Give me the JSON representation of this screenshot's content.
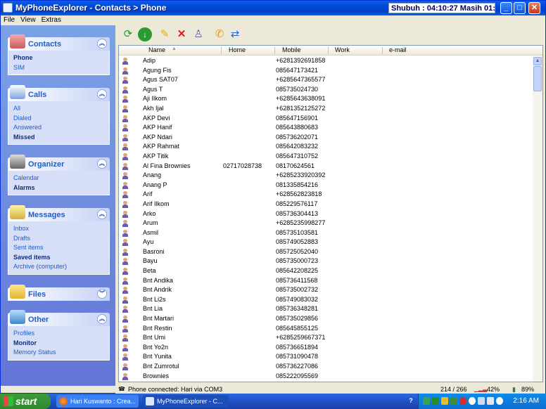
{
  "window": {
    "title": "MyPhoneExplorer  -  Contacts > Phone",
    "timer": "Shubuh : 04:10:27  Masih 01:54:25"
  },
  "menu": [
    "File",
    "View",
    "Extras"
  ],
  "sidebar": {
    "groups": [
      {
        "label": "Contacts",
        "items": [
          {
            "label": "Phone",
            "bold": true
          },
          {
            "label": "SIM",
            "bold": false
          }
        ]
      },
      {
        "label": "Calls",
        "items": [
          {
            "label": "All",
            "bold": false
          },
          {
            "label": "Dialed",
            "bold": false
          },
          {
            "label": "Answered",
            "bold": false
          },
          {
            "label": "Missed",
            "bold": true
          }
        ]
      },
      {
        "label": "Organizer",
        "items": [
          {
            "label": "Calendar",
            "bold": false
          },
          {
            "label": "Alarms",
            "bold": true
          }
        ]
      },
      {
        "label": "Messages",
        "items": [
          {
            "label": "Inbox",
            "bold": false
          },
          {
            "label": "Drafts",
            "bold": false
          },
          {
            "label": "Sent items",
            "bold": false
          },
          {
            "label": "Saved items",
            "bold": true
          },
          {
            "label": "Archive (computer)",
            "bold": false
          }
        ]
      },
      {
        "label": "Files",
        "items": []
      },
      {
        "label": "Other",
        "items": [
          {
            "label": "Profiles",
            "bold": false
          },
          {
            "label": "Monitor",
            "bold": true
          },
          {
            "label": "Memory Status",
            "bold": false
          }
        ]
      }
    ]
  },
  "toolbar": {
    "icons": [
      "refresh-icon",
      "download-icon",
      "edit-icon",
      "delete-icon",
      "add-contact-icon",
      "phone-icon",
      "sync-icon"
    ]
  },
  "table": {
    "columns": [
      "Name",
      "Home",
      "Mobile",
      "Work",
      "e-mail"
    ],
    "rows": [
      {
        "name": "Adip",
        "home": "",
        "mobile": "+6281392691858"
      },
      {
        "name": "Agung Fis",
        "home": "",
        "mobile": "085647173421"
      },
      {
        "name": "Agus SAT07",
        "home": "",
        "mobile": "+6285647365577"
      },
      {
        "name": "Agus T",
        "home": "",
        "mobile": "085735024730"
      },
      {
        "name": "Aji Ilkom",
        "home": "",
        "mobile": "+6285643638091"
      },
      {
        "name": "Akh Ijal",
        "home": "",
        "mobile": "+6281352125272"
      },
      {
        "name": "AKP Devi",
        "home": "",
        "mobile": "085647156901"
      },
      {
        "name": "AKP Hanif",
        "home": "",
        "mobile": "085643880683"
      },
      {
        "name": "AKP Ndari",
        "home": "",
        "mobile": "085736202071"
      },
      {
        "name": "AKP Rahmat",
        "home": "",
        "mobile": "085642083232"
      },
      {
        "name": "AKP Titik",
        "home": "",
        "mobile": "085647310752"
      },
      {
        "name": "Al Fina Brownies",
        "home": "02717028738",
        "mobile": "08170624561"
      },
      {
        "name": "Anang",
        "home": "",
        "mobile": "+6285233920392"
      },
      {
        "name": "Anang P",
        "home": "",
        "mobile": "081335854216"
      },
      {
        "name": "Arif",
        "home": "",
        "mobile": "+628562823818"
      },
      {
        "name": "Arif Ilkom",
        "home": "",
        "mobile": "085229576117"
      },
      {
        "name": "Arko",
        "home": "",
        "mobile": "085736304413"
      },
      {
        "name": "Arum",
        "home": "",
        "mobile": "+6285235998277"
      },
      {
        "name": "Asmil",
        "home": "",
        "mobile": "085735103581"
      },
      {
        "name": "Ayu",
        "home": "",
        "mobile": "085749052883"
      },
      {
        "name": "Basroni",
        "home": "",
        "mobile": "085725052040"
      },
      {
        "name": "Bayu",
        "home": "",
        "mobile": "085735000723"
      },
      {
        "name": "Beta",
        "home": "",
        "mobile": "085642208225"
      },
      {
        "name": "Bnt Andika",
        "home": "",
        "mobile": "085736411568"
      },
      {
        "name": "Bnt Andrik",
        "home": "",
        "mobile": "085735002732"
      },
      {
        "name": "Bnt Li2s",
        "home": "",
        "mobile": "085749083032"
      },
      {
        "name": "Bnt Lia",
        "home": "",
        "mobile": "085736348281"
      },
      {
        "name": "Bnt Martari",
        "home": "",
        "mobile": "085735029856"
      },
      {
        "name": "Bnt Restin",
        "home": "",
        "mobile": "085645855125"
      },
      {
        "name": "Bnt Umi",
        "home": "",
        "mobile": "+6285259667371"
      },
      {
        "name": "Bnt Yo2n",
        "home": "",
        "mobile": "085736651894"
      },
      {
        "name": "Bnt Yunita",
        "home": "",
        "mobile": "085731090478"
      },
      {
        "name": "Bnt Zumrotul",
        "home": "",
        "mobile": "085736227086"
      },
      {
        "name": "Brownies",
        "home": "",
        "mobile": "085222095569"
      }
    ]
  },
  "status": {
    "connection": "Phone connected: Hari via COM3",
    "count": "214 / 266",
    "signal": "42%",
    "battery": "89%"
  },
  "taskbar": {
    "start": "start",
    "tasks": [
      "Hari Kuswanto : Crea...",
      "MyPhoneExplorer - C..."
    ],
    "clock": "2:16 AM"
  }
}
